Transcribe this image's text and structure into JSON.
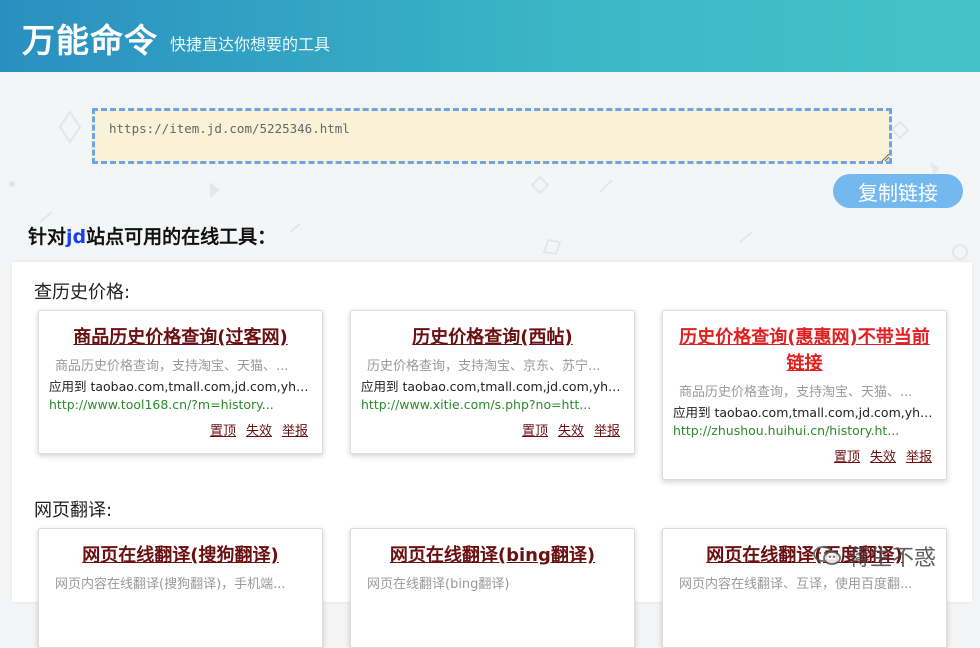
{
  "header": {
    "title": "万能命令",
    "subtitle": "快捷直达你想要的工具"
  },
  "input": {
    "value": "https://item.jd.com/5225346.html"
  },
  "copy_button": {
    "label": "复制链接"
  },
  "section": {
    "prefix": "针对",
    "site": "jd",
    "suffix": "站点可用的在线工具："
  },
  "categories": [
    {
      "title": "查历史价格:",
      "cards": [
        {
          "title": "商品历史价格查询(过客网)",
          "desc": "商品历史价格查询，支持淘宝、天猫、...",
          "apply": "应用到 taobao.com,tmall.com,jd.com,yhd.co...",
          "url": "http://www.tool168.cn/?m=history..."
        },
        {
          "title": "历史价格查询(西帖)",
          "desc": "历史价格查询，支持淘宝、京东、苏宁...",
          "apply": "应用到 taobao.com,tmall.com,jd.com,yhd.co...",
          "url": "http://www.xitie.com/s.php?no=htt..."
        },
        {
          "title": "历史价格查询(惠惠网)不带当前链接",
          "desc": "商品历史价格查询，支持淘宝、天猫、...",
          "apply": "应用到 taobao.com,tmall.com,jd.com,yhd.co...",
          "url": "http://zhushou.huihui.cn/history.ht..."
        }
      ]
    },
    {
      "title": "网页翻译:",
      "cards": [
        {
          "title": "网页在线翻译(搜狗翻译)",
          "desc": "网页内容在线翻译(搜狗翻译)，手机端..."
        },
        {
          "title": "网页在线翻译(bing翻译)",
          "desc": "网页在线翻译(bing翻译)"
        },
        {
          "title": "网页在线翻译(百度翻译)",
          "desc": "网页内容在线翻译、互译，使用百度翻..."
        }
      ]
    }
  ],
  "card_actions": {
    "top": "置顶",
    "invalid": "失效",
    "report": "举报"
  },
  "watermark": {
    "text": "蒋生不惑"
  },
  "colors": {
    "header_start": "#2a8fc0",
    "header_end": "#43c3c8",
    "button": "#74b8f0",
    "card_title": "#6a1010",
    "card_title_highlight": "#e02020",
    "url_green": "#2c8a2c",
    "site_blue": "#1a3ef0"
  }
}
